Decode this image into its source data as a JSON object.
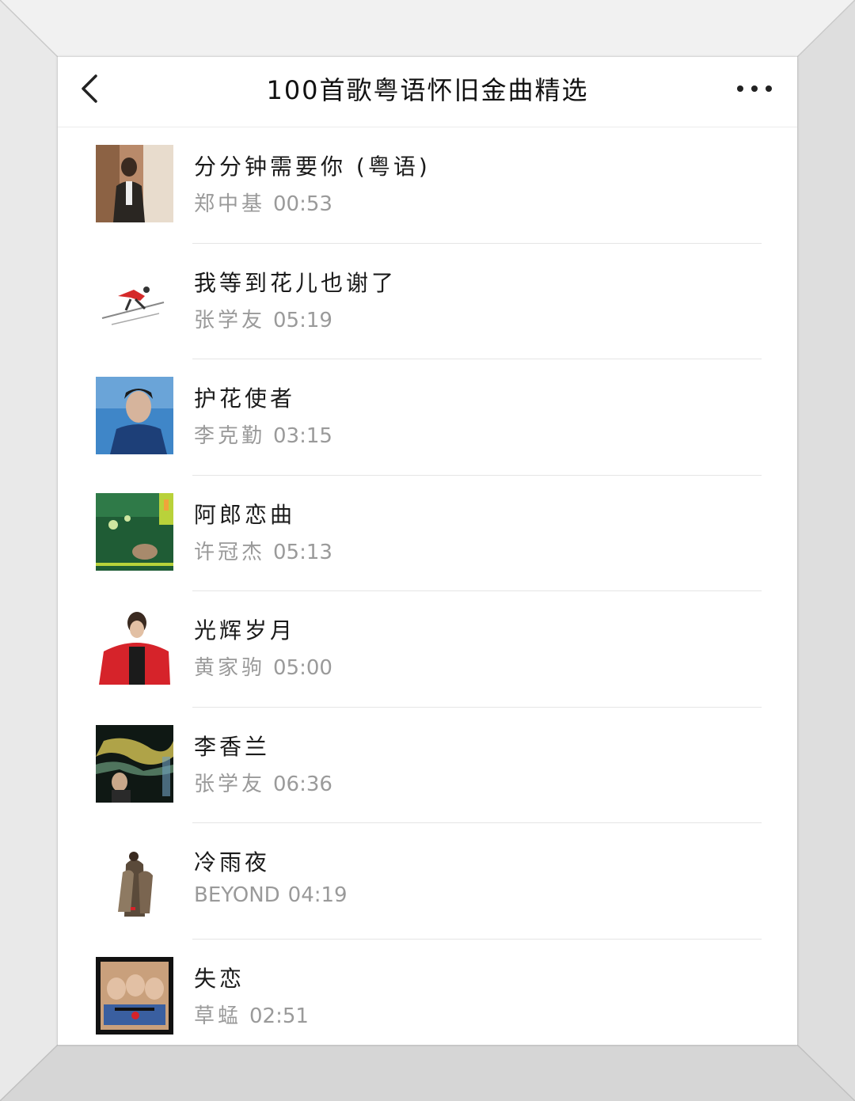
{
  "header": {
    "title": "100首歌粤语怀旧金曲精选",
    "back_icon": "chevron-left-icon",
    "more_icon": "more-horizontal-icon"
  },
  "songs": [
    {
      "title": "分分钟需要你 (粤语)",
      "artist": "郑中基",
      "duration": "00:53",
      "cover_colors": [
        "#b98a6a",
        "#2a2622",
        "#e8dccd"
      ]
    },
    {
      "title": "我等到花儿也谢了",
      "artist": "张学友",
      "duration": "05:19",
      "cover_colors": [
        "#ffffff",
        "#d52a2a",
        "#333333"
      ]
    },
    {
      "title": "护花使者",
      "artist": "李克勤",
      "duration": "03:15",
      "cover_colors": [
        "#3f86c8",
        "#1d3f78",
        "#d6b49c"
      ]
    },
    {
      "title": "阿郎恋曲",
      "artist": "许冠杰",
      "duration": "05:13",
      "cover_colors": [
        "#1f5c35",
        "#b9d23a",
        "#f0a43a"
      ]
    },
    {
      "title": "光辉岁月",
      "artist": "黄家驹",
      "duration": "05:00",
      "cover_colors": [
        "#ffffff",
        "#d6232a",
        "#1b1b1b"
      ]
    },
    {
      "title": "李香兰",
      "artist": "张学友",
      "duration": "06:36",
      "cover_colors": [
        "#0f1814",
        "#e6d25a",
        "#5f8c6f"
      ]
    },
    {
      "title": "冷雨夜",
      "artist": "BEYOND",
      "duration": "04:19",
      "cover_colors": [
        "#ffffff",
        "#5a4a3a",
        "#8e7a62"
      ]
    },
    {
      "title": "失恋",
      "artist": "草蜢",
      "duration": "02:51",
      "cover_colors": [
        "#111111",
        "#c9a07c",
        "#3a5fa0"
      ]
    }
  ]
}
